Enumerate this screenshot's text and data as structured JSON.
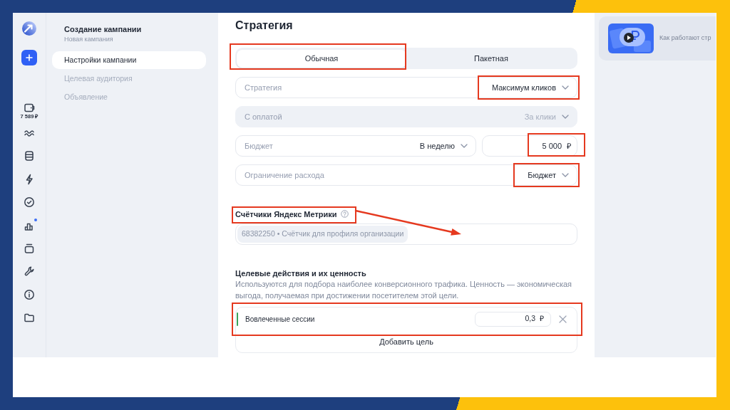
{
  "rail": {
    "items": [
      {
        "caption": "7 589 ₽",
        "dot": false
      },
      {
        "dot": false
      },
      {
        "dot": false
      },
      {
        "dot": false
      },
      {
        "dot": false
      },
      {
        "dot": true
      },
      {
        "dot": false
      },
      {
        "dot": false
      },
      {
        "dot": false
      },
      {
        "dot": false
      }
    ]
  },
  "nav": {
    "title": "Создание кампании",
    "subtitle": "Новая кампания",
    "items": [
      {
        "label": "Настройки кампании",
        "selected": true
      },
      {
        "label": "Целевая аудитория",
        "selected": false
      },
      {
        "label": "Объявление",
        "selected": false
      }
    ]
  },
  "strategy": {
    "title": "Стратегия",
    "tabs": [
      {
        "label": "Обычная",
        "selected": true,
        "highlighted": true
      },
      {
        "label": "Пакетная",
        "selected": false,
        "highlighted": false
      }
    ],
    "fields": [
      {
        "kind": "select",
        "label": "Стратегия",
        "value": "Максимум кликов",
        "disabled": false,
        "highlighted": true
      },
      {
        "kind": "select",
        "label": "С оплатой",
        "value": "За клики",
        "disabled": true,
        "highlighted": false
      },
      {
        "kind": "budget",
        "label": "Бюджет",
        "value": "В неделю",
        "amount": "5 000",
        "currency": "₽",
        "disabled": false,
        "amount_highlighted": true
      },
      {
        "kind": "select",
        "label": "Ограничение расхода",
        "value": "Бюджет",
        "disabled": false,
        "highlighted": true
      }
    ]
  },
  "counters": {
    "title": "Счётчики Яндекс Метрики",
    "highlighted": true,
    "arrow": true,
    "chips": [
      {
        "label": "68382250 • Счётчик для профиля организации"
      }
    ]
  },
  "goals": {
    "title": "Целевые действия и их ценность",
    "description": "Используются для подбора наиболее конверсионного трафика. Ценность — экономическая выгода, получаемая при достижении посетителем этой цели.",
    "items": [
      {
        "name": "Вовлеченные сессии",
        "value": "0,3",
        "currency": "₽",
        "highlighted": true
      }
    ],
    "add_label": "Добавить цель"
  },
  "help": {
    "video_title": "Как работают стр"
  }
}
